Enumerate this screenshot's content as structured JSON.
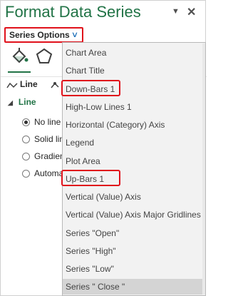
{
  "pane": {
    "title": "Format Data Series",
    "options_dropdown_glyph": "▼",
    "close_glyph": "✕"
  },
  "series_options": {
    "label": "Series Options",
    "chevron": "∨"
  },
  "tabs": [
    {
      "icon": "paint-bucket-icon"
    },
    {
      "icon": "pentagon-effects-icon"
    }
  ],
  "subtabs": {
    "line_label": "Line",
    "marker_label": "Marker"
  },
  "line_section": {
    "header": "Line",
    "expand_glyph": "◢",
    "options": [
      {
        "label": "No line",
        "selected": true
      },
      {
        "label": "Solid line",
        "selected": false
      },
      {
        "label": "Gradient line",
        "selected": false
      },
      {
        "label": "Automatic",
        "selected": false
      }
    ]
  },
  "dropdown": {
    "items": [
      {
        "label": "Chart Area"
      },
      {
        "label": "Chart Title"
      },
      {
        "label": "Down-Bars 1",
        "highlighted": true
      },
      {
        "label": "High-Low Lines 1"
      },
      {
        "label": "Horizontal (Category) Axis"
      },
      {
        "label": "Legend"
      },
      {
        "label": "Plot Area"
      },
      {
        "label": "Up-Bars 1",
        "highlighted": true
      },
      {
        "label": "Vertical (Value) Axis"
      },
      {
        "label": "Vertical (Value) Axis Major Gridlines"
      },
      {
        "label": "Series \"Open\""
      },
      {
        "label": "Series \"High\""
      },
      {
        "label": "Series \"Low\""
      },
      {
        "label": "Series \" Close \"",
        "selected": true
      }
    ]
  },
  "colors": {
    "accent": "#217346",
    "highlight": "#e0111b",
    "chevron": "#1f6fb8"
  }
}
